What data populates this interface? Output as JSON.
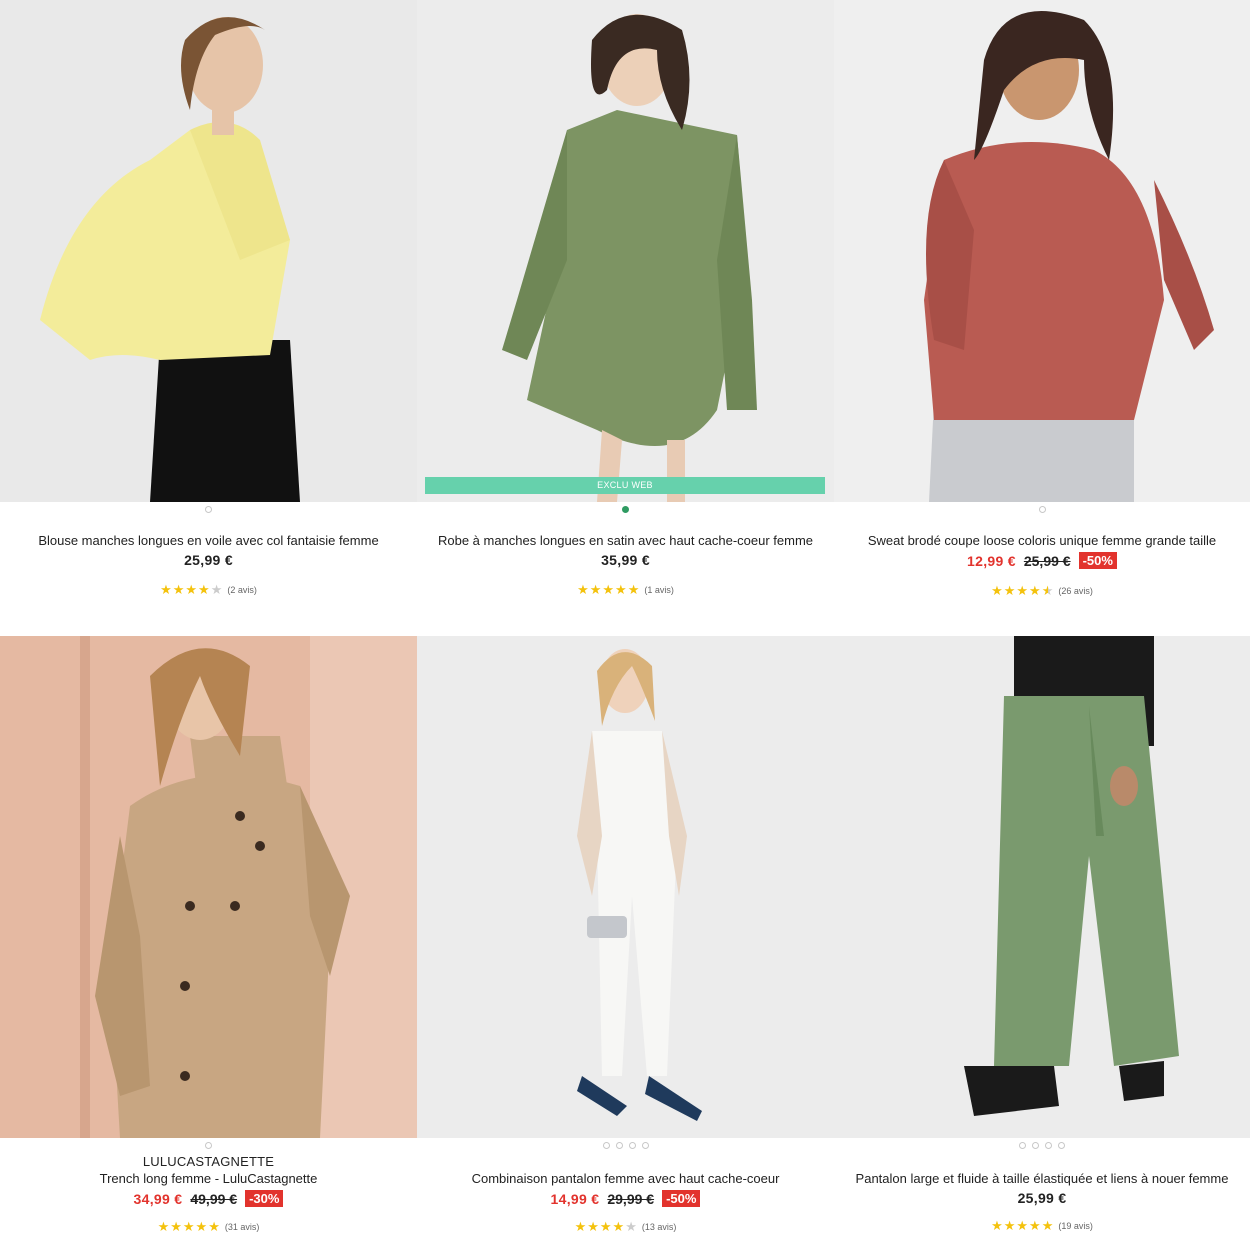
{
  "products": [
    {
      "title": "Blouse manches longues en voile avec col fantaisie femme",
      "price": "25,99 €",
      "rating": 4,
      "reviews": "(2 avis)",
      "dots": 1,
      "active_dot": -1
    },
    {
      "badge_top": "EXCLU WEB",
      "title": "Robe à manches longues en satin avec haut cache-coeur femme",
      "price": "35,99 €",
      "rating": 5,
      "reviews": "(1 avis)",
      "dots": 1,
      "active_dot": 0
    },
    {
      "title": "Sweat brodé coupe loose coloris unique femme grande taille",
      "sale_price": "12,99 €",
      "old_price": "25,99 €",
      "discount": "-50%",
      "rating": 4.5,
      "reviews": "(26 avis)",
      "dots": 1,
      "active_dot": -1
    },
    {
      "brand": "LULUCASTAGNETTE",
      "title": "Trench long femme - LuluCastagnette",
      "sale_price": "34,99 €",
      "old_price": "49,99 €",
      "discount": "-30%",
      "rating": 5,
      "reviews": "(31 avis)",
      "dots": 1,
      "active_dot": -1
    },
    {
      "title": "Combinaison pantalon femme avec haut cache-coeur",
      "sale_price": "14,99 €",
      "old_price": "29,99 €",
      "discount": "-50%",
      "rating": 4,
      "reviews": "(13 avis)",
      "dots": 4,
      "active_dot": -1
    },
    {
      "title": "Pantalon large et fluide à taille élastiquée et liens à nouer femme",
      "price": "25,99 €",
      "rating": 5,
      "reviews": "(19 avis)",
      "dots": 4,
      "active_dot": -1
    }
  ],
  "colors": {
    "sale": "#e2332d",
    "star": "#f4c20d",
    "exclu_badge": "#66d1ac",
    "active_dot": "#2f9b62"
  }
}
